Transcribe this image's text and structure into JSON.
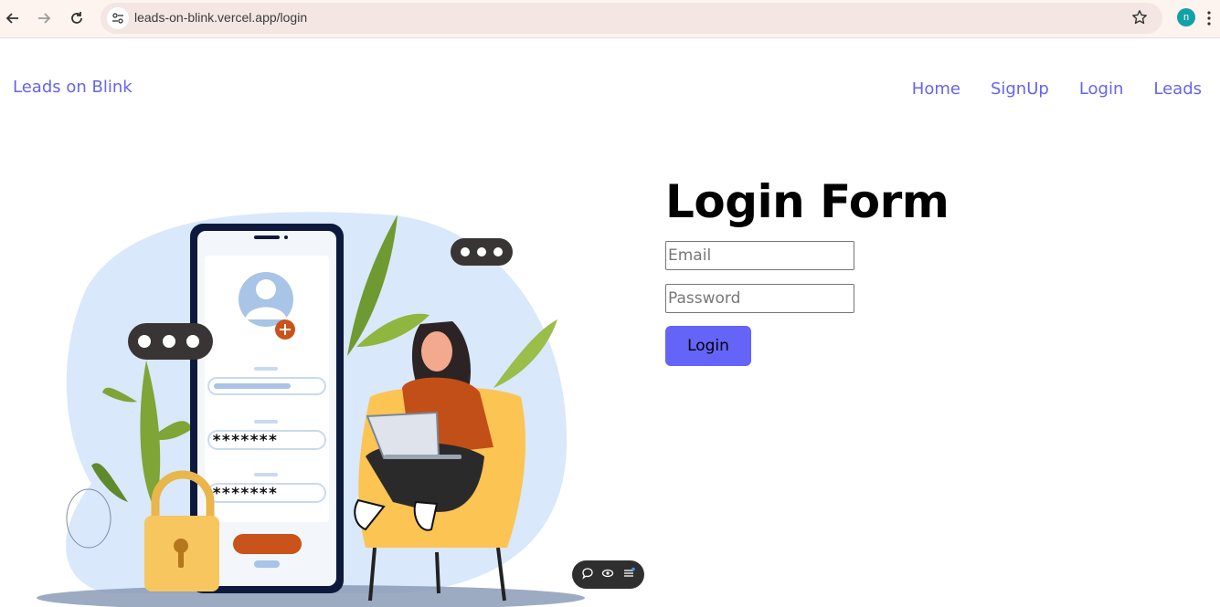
{
  "browser": {
    "url": "leads-on-blink.vercel.app/login",
    "profile_initial": "n",
    "profile_color": "#13a1a8"
  },
  "site": {
    "brand": "Leads on Blink",
    "nav": [
      {
        "label": "Home"
      },
      {
        "label": "SignUp"
      },
      {
        "label": "Login"
      },
      {
        "label": "Leads"
      }
    ],
    "accent_color": "#6464f2"
  },
  "illustration": {
    "password_mask_1": "*******",
    "password_mask_2": "*******"
  },
  "form": {
    "title": "Login Form",
    "email_placeholder": "Email",
    "password_placeholder": "Password",
    "submit_label": "Login"
  },
  "icons": [
    "back-arrow-icon",
    "forward-arrow-icon",
    "reload-icon",
    "site-settings-icon",
    "bookmark-star-icon",
    "kebab-menu-icon",
    "comment-icon",
    "eye-icon",
    "list-icon"
  ]
}
